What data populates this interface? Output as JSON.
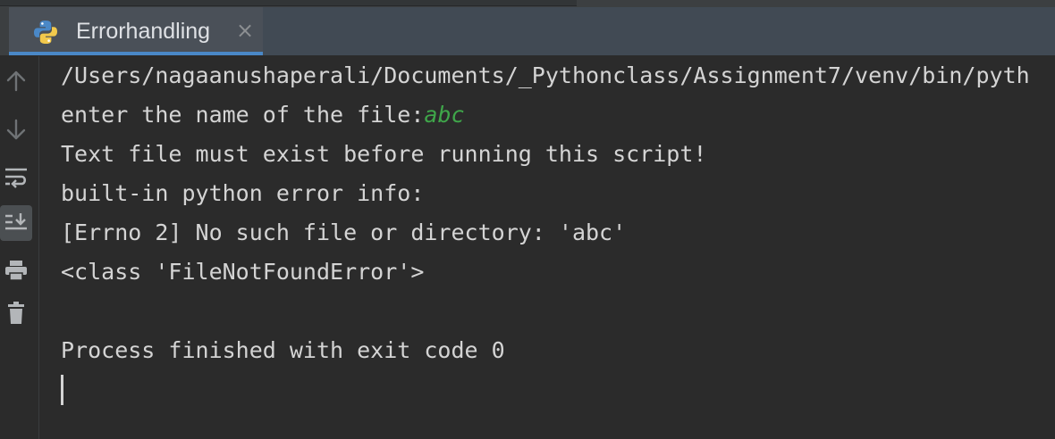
{
  "tab": {
    "title": "Errorhandling",
    "close_glyph": "×"
  },
  "sidebar": {
    "tools": [
      {
        "icon": "arrow-up-icon"
      },
      {
        "icon": "arrow-down-icon"
      },
      {
        "icon": "soft-wrap-icon"
      },
      {
        "icon": "scroll-to-end-icon",
        "active": true
      },
      {
        "icon": "print-icon"
      },
      {
        "icon": "trash-icon"
      }
    ]
  },
  "console": {
    "command_line": "/Users/nagaanushaperali/Documents/_Pythonclass/Assignment7/venv/bin/pyth",
    "prompt": "enter the name of the file:",
    "user_input": "abc",
    "output_lines": [
      "Text file must exist before running this script!",
      "built-in python error info:",
      "[Errno 2] No such file or directory: 'abc'",
      "<class 'FileNotFoundError'>"
    ],
    "exit_message": "Process finished with exit code 0"
  },
  "colors": {
    "background": "#2b2b2b",
    "text": "#d4d4d4",
    "input_text": "#3fa64a",
    "tab_accent": "#4a88c7"
  }
}
